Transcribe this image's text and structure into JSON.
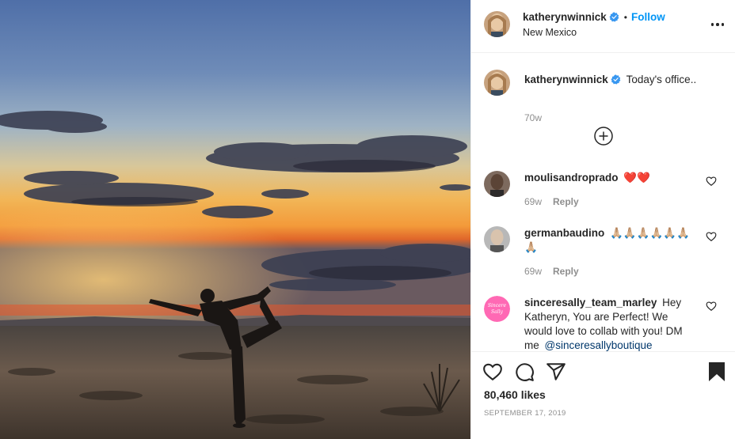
{
  "post": {
    "username": "katherynwinnick",
    "follow_label": "Follow",
    "separator": "•",
    "location": "New Mexico"
  },
  "caption": {
    "username": "katherynwinnick",
    "text": "Today's office..",
    "time": "70w"
  },
  "comments": [
    {
      "username": "moulisandroprado",
      "text": "❤️❤️",
      "time": "69w",
      "reply_label": "Reply"
    },
    {
      "username": "germanbaudino",
      "text": "🙏🏼🙏🏼🙏🏼🙏🏼🙏🏼🙏🏼🙏🏼",
      "time": "69w",
      "reply_label": "Reply"
    },
    {
      "username": "sinceresally_team_marley",
      "text": "Hey Katheryn, You are Perfect! We would love to collab with you! DM me",
      "mention": "@sinceresallyboutique",
      "avatar_text": "Sincere Sally"
    }
  ],
  "stats": {
    "likes": "80,460 likes",
    "date": "SEPTEMBER 17, 2019"
  },
  "colors": {
    "link": "#0095f6",
    "verified": "#3897f0",
    "text": "#262626",
    "muted": "#8e8e8e",
    "brand_avatar": "#ff69b4"
  },
  "icons": [
    "verified-badge-icon",
    "more-options-icon",
    "load-more-plus-icon",
    "heart-icon",
    "comment-icon",
    "share-icon",
    "bookmark-icon"
  ]
}
